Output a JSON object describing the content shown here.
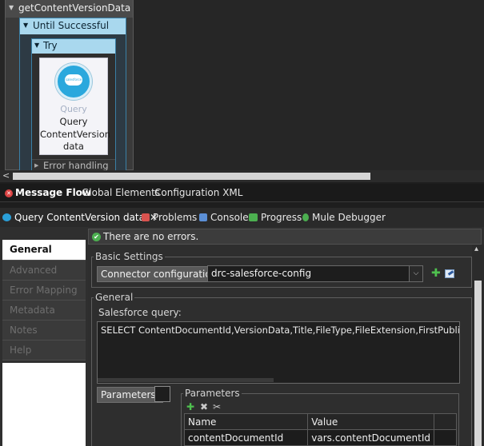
{
  "canvas": {
    "flow_name": "getContentVersionData",
    "scope_name": "Until Successful",
    "try_name": "Try",
    "component": {
      "icon_text": "salesforce",
      "type_label": "Query",
      "name_line1": "Query",
      "name_line2": "ContentVersion",
      "name_line3": "data"
    },
    "error_handling_label": "Error handling",
    "scroll_left_arrow": "<"
  },
  "editor_tabs": [
    {
      "label": "Message Flow"
    },
    {
      "label": "Global Elements"
    },
    {
      "label": "Configuration XML"
    }
  ],
  "view_tabs": [
    {
      "label": "Query ContentVersion data",
      "icon_color": "#2a9fd8"
    },
    {
      "label": "Problems",
      "icon_color": "#d9534f"
    },
    {
      "label": "Console",
      "icon_color": "#5b8fd6"
    },
    {
      "label": "Progress",
      "icon_color": "#4caf50"
    },
    {
      "label": "Mule Debugger",
      "icon_color": "#4caf50"
    }
  ],
  "close_symbol": "✕",
  "sidebar": {
    "items": [
      {
        "label": "General"
      },
      {
        "label": "Advanced"
      },
      {
        "label": "Error Mapping"
      },
      {
        "label": "Metadata"
      },
      {
        "label": "Notes"
      },
      {
        "label": "Help"
      }
    ]
  },
  "status": {
    "message": "There are no errors.",
    "check": "✔"
  },
  "basic_settings": {
    "legend": "Basic Settings",
    "connector_label": "Connector configuration:",
    "connector_value": "drc-salesforce-config",
    "add_symbol": "✚",
    "dropdown_symbol": "⌵"
  },
  "general": {
    "legend": "General",
    "query_label": "Salesforce query:",
    "query_text": "SELECT ContentDocumentId,VersionData,Title,FileType,FileExtension,FirstPublishLocation",
    "parameters_label": "Parameters:"
  },
  "parameters": {
    "legend": "Parameters",
    "tool_add": "✚",
    "tool_delete": "✖",
    "tool_clear": "✂",
    "columns": [
      "Name",
      "Value"
    ],
    "rows": [
      {
        "name": "contentDocumentId",
        "value": "vars.contentDocumentId"
      }
    ]
  },
  "scroll_up_arrow": "▴"
}
